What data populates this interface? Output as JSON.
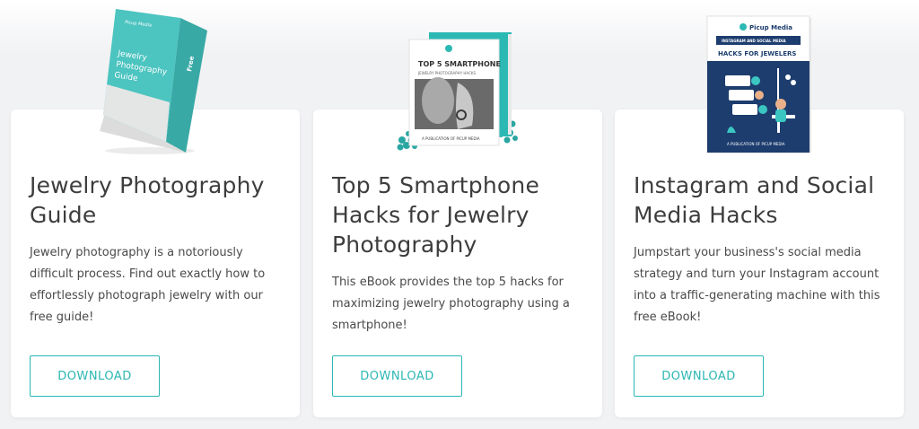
{
  "cards": [
    {
      "title": "Jewelry Photography Guide",
      "description": "Jewelry photography is a notoriously difficult process. Find out exactly how to effortlessly photograph jewelry with our free guide!",
      "button_label": "DOWNLOAD",
      "cover": {
        "brand": "Picup Media",
        "text": "Jewelry Photography Guide",
        "spine_text": "Free"
      }
    },
    {
      "title": "Top 5 Smartphone Hacks for Jewelry Photography",
      "description": "This eBook provides the top 5 hacks for maximizing jewelry photography using a smartphone!",
      "button_label": "DOWNLOAD",
      "cover": {
        "title": "TOP 5 SMARTPHONE",
        "subtitle": "JEWELRY PHOTOGRAPHY HACKS",
        "footer": "A PUBLICATION OF PICUP MEDIA"
      }
    },
    {
      "title": "Instagram and Social Media Hacks",
      "description": "Jumpstart your business's social media strategy and turn your Instagram account into a traffic-generating machine with this free eBook!",
      "button_label": "DOWNLOAD",
      "cover": {
        "brand": "Picup Media",
        "kicker": "INSTAGRAM AND SOCIAL MEDIA",
        "title": "HACKS FOR JEWELERS",
        "footer": "A PUBLICATION OF PICUP MEDIA"
      }
    }
  ],
  "colors": {
    "accent": "#2bb7b3",
    "teal_cover": "#4cc4c0",
    "navy_cover": "#1d3d6e",
    "page_bg": "#f1f2f4"
  }
}
